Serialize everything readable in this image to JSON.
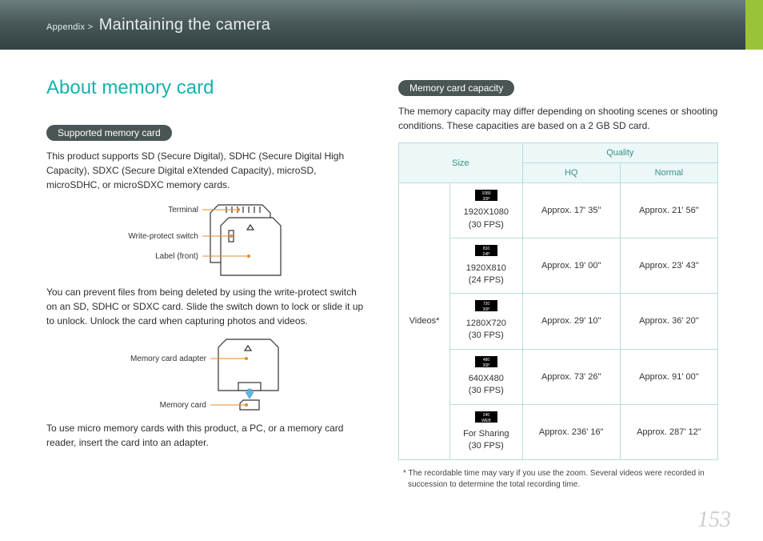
{
  "breadcrumb": {
    "section": "Appendix >",
    "title": "Maintaining the camera"
  },
  "page_title": "About memory card",
  "left": {
    "heading1": "Supported memory card",
    "para1": "This product supports SD (Secure Digital), SDHC (Secure Digital High Capacity), SDXC (Secure Digital eXtended Capacity), microSD, microSDHC, or microSDXC memory cards.",
    "diagram1": {
      "terminal": "Terminal",
      "write_protect": "Write-protect switch",
      "label_front": "Label (front)"
    },
    "para2": "You can prevent files from being deleted by using the write-protect switch on an SD, SDHC or SDXC card. Slide the switch down to lock or slide it up to unlock. Unlock the card when capturing photos and videos.",
    "diagram2": {
      "adapter": "Memory card adapter",
      "card": "Memory card"
    },
    "para3": "To use micro memory cards with this product, a PC, or a memory card reader, insert the card into an adapter."
  },
  "right": {
    "heading1": "Memory card capacity",
    "para1": "The memory capacity may differ depending on shooting scenes or shooting conditions. These capacities are based on a 2 GB SD card.",
    "table": {
      "headers": {
        "size": "Size",
        "quality": "Quality",
        "hq": "HQ",
        "normal": "Normal"
      },
      "group_label": "Videos*",
      "rows": [
        {
          "icon": "1080/30P",
          "size_line1": "1920X1080",
          "fps": "(30 FPS)",
          "hq": "Approx. 17' 35\"",
          "normal": "Approx. 21' 56\""
        },
        {
          "icon": "810/24P",
          "size_line1": "1920X810",
          "fps": "(24 FPS)",
          "hq": "Approx. 19' 00\"",
          "normal": "Approx. 23' 43\""
        },
        {
          "icon": "720/30P",
          "size_line1": "1280X720",
          "fps": "(30 FPS)",
          "hq": "Approx. 29' 10\"",
          "normal": "Approx. 36' 20\""
        },
        {
          "icon": "480/30P",
          "size_line1": "640X480",
          "fps": "(30 FPS)",
          "hq": "Approx. 73' 26\"",
          "normal": "Approx. 91' 00\""
        },
        {
          "icon": "240/WEB",
          "size_line1": "For Sharing",
          "fps": "(30 FPS)",
          "hq": "Approx. 236' 16\"",
          "normal": "Approx. 287' 12\""
        }
      ]
    },
    "footnote": "* The recordable time may vary if you use the zoom. Several videos were recorded in succession to determine the total recording time."
  },
  "page_number": "153"
}
